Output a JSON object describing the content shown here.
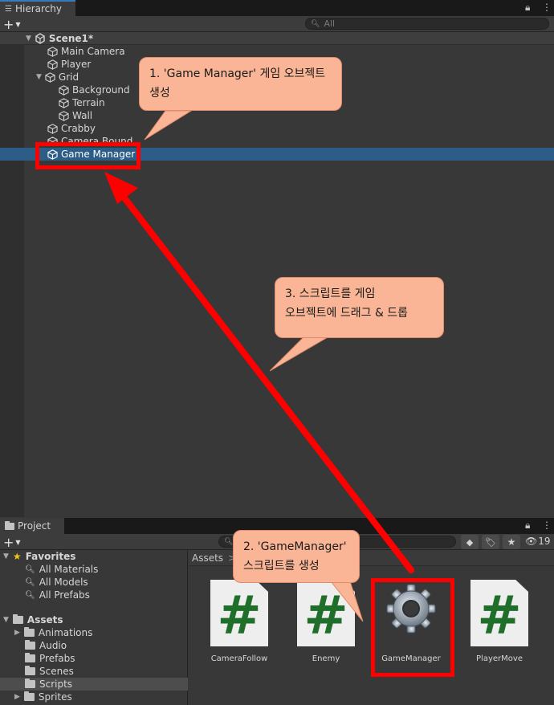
{
  "hierarchy": {
    "tab_label": "Hierarchy",
    "search_placeholder": "All",
    "scene_name": "Scene1*",
    "items": [
      {
        "label": "Main Camera"
      },
      {
        "label": "Player"
      },
      {
        "label": "Grid"
      },
      {
        "label": "Background"
      },
      {
        "label": "Terrain"
      },
      {
        "label": "Wall"
      },
      {
        "label": "Crabby"
      },
      {
        "label": "Camera Bound"
      },
      {
        "label": "Game Manager"
      }
    ]
  },
  "project": {
    "tab_label": "Project",
    "hidden_count": "19",
    "favorites": {
      "label": "Favorites",
      "items": [
        "All Materials",
        "All Models",
        "All Prefabs"
      ]
    },
    "assets": {
      "label": "Assets",
      "folders": [
        "Animations",
        "Audio",
        "Prefabs",
        "Scenes",
        "Scripts",
        "Sprites"
      ]
    },
    "breadcrumb": "Assets",
    "files": [
      "CameraFollow",
      "Enemy",
      "GameManager",
      "PlayerMove"
    ]
  },
  "callouts": {
    "step1": [
      "1. 'Game Manager' 게임 오브젝트",
      "생성"
    ],
    "step2": [
      "2. 'GameManager'",
      "스크립트를 생성"
    ],
    "step3": [
      "3. 스크립트를 게임",
      "오브젝트에 드래그 & 드롭"
    ]
  },
  "colors": {
    "selection": "#2c5d87",
    "highlight_red": "#ff0000",
    "callout_fill": "#f9b595",
    "script_hash": "#1f6e2a"
  }
}
